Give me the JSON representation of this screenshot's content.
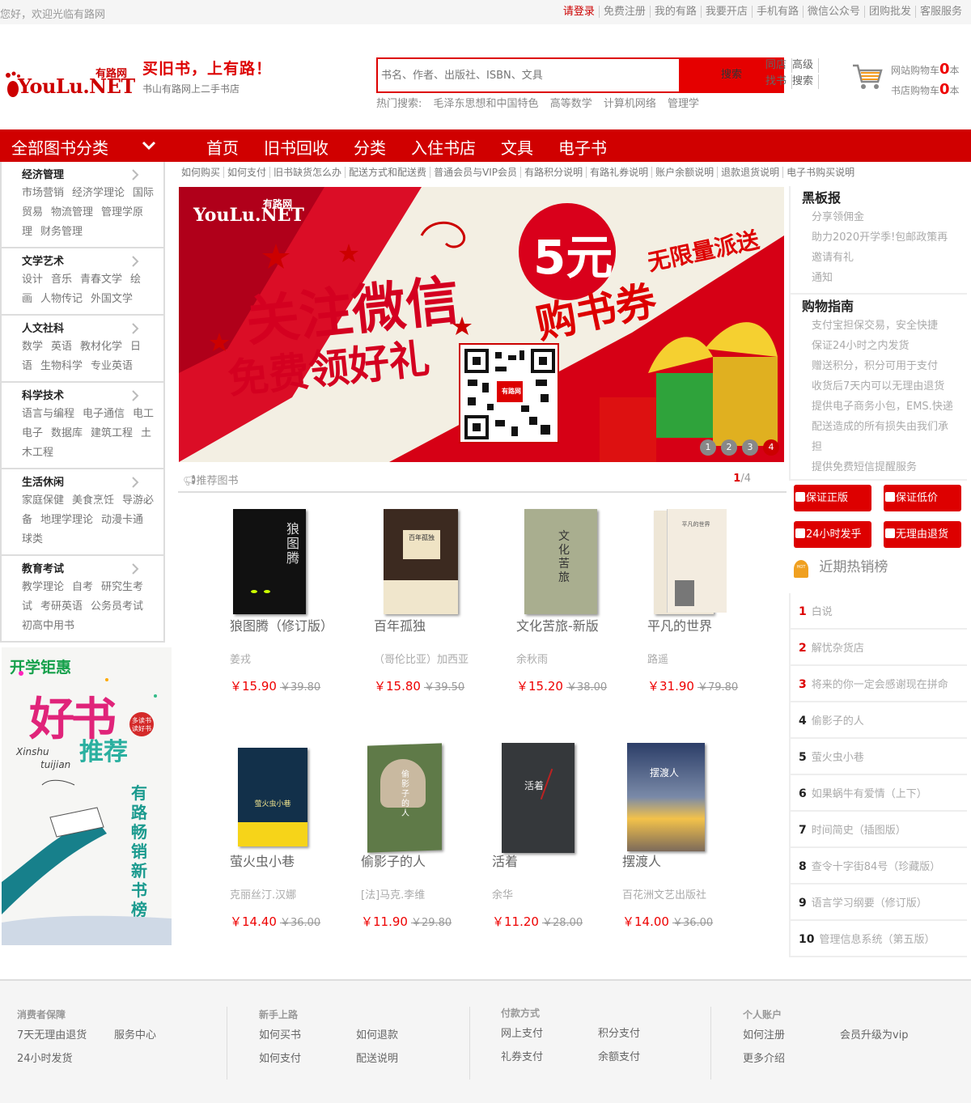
{
  "topbar": {
    "welcome": "您好，欢迎光临有路网",
    "links": [
      "请登录",
      "免费注册",
      "我的有路",
      "我要开店",
      "手机有路",
      "微信公众号",
      "团购批发",
      "客服服务"
    ]
  },
  "header": {
    "logo_text": "YouLu.NET",
    "logo_cn": "有路网",
    "slogan": "买旧书，上有路！",
    "sub_slogan": "书山有路网上二手书店",
    "search_placeholder": "书名、作者、出版社、ISBN、文具",
    "search_button": "搜索",
    "extra_links": [
      "同店",
      "高级",
      "找书",
      "搜索"
    ],
    "hot_label": "热门搜索:",
    "hot_terms": [
      "毛泽东思想和中国特色",
      "高等数学",
      "计算机网络",
      "管理学"
    ],
    "cart_site_label": "网站购物车",
    "cart_site_count": "0",
    "cart_shop_label": "书店购物车",
    "cart_shop_count": "0",
    "cart_unit": "本"
  },
  "nav": {
    "all_categories": "全部图书分类",
    "items": [
      "首页",
      "旧书回收",
      "分类",
      "入住书店",
      "文具",
      "电子书"
    ]
  },
  "categories": [
    {
      "title": "经济管理",
      "subs": [
        "市场营销",
        "经济学理论",
        "国际贸易",
        "物流管理",
        "管理学原理",
        "财务管理"
      ]
    },
    {
      "title": "文学艺术",
      "subs": [
        "设计",
        "音乐",
        "青春文学",
        "绘画",
        "人物传记",
        "外国文学"
      ]
    },
    {
      "title": "人文社科",
      "subs": [
        "数学",
        "英语",
        "教材化学",
        "日语",
        "生物科学",
        "专业英语"
      ]
    },
    {
      "title": "科学技术",
      "subs": [
        "语言与编程",
        "电子通信",
        "电工电子",
        "数据库",
        "建筑工程",
        "土木工程"
      ]
    },
    {
      "title": "生活休闲",
      "subs": [
        "家庭保健",
        "美食烹饪",
        "导游必备",
        "地理学理论",
        "动漫卡通",
        "球类"
      ]
    },
    {
      "title": "教育考试",
      "subs": [
        "教学理论",
        "自考",
        "研究生考试",
        "考研英语",
        "公务员考试",
        "初高中用书"
      ]
    }
  ],
  "side_promo": {
    "head": "开学钜惠",
    "big": "好书",
    "big2": "推荐",
    "pinyin1": "Xinshu",
    "pinyin2": "tuijian",
    "tag": "多读书 读好书",
    "vertical": "有路畅销新书榜"
  },
  "help_links": [
    "如何购买",
    "如何支付",
    "旧书缺货怎么办",
    "配送方式和配送费",
    "普通会员与VIP会员",
    "有路积分说明",
    "有路礼券说明",
    "账户余额说明",
    "退款退货说明",
    "电子书购买说明"
  ],
  "banner": {
    "logo_cn": "有路网",
    "logo_text": "YouLu.NET",
    "amount": "5元",
    "unlimited": "无限量派送",
    "coupon": "购书券",
    "follow": "关注微信",
    "gift": "免费领好礼",
    "qr_label": "有路网",
    "dots": [
      "1",
      "2",
      "3",
      "4"
    ],
    "active_dot": "4"
  },
  "recommend": {
    "label": "推荐图书",
    "page_current": "1",
    "page_total": "/4"
  },
  "books": [
    {
      "name": "狼图腾（修订版）",
      "author": "姜戎",
      "price": "￥15.90",
      "old": "￥39.80",
      "cover_title": "狼图腾"
    },
    {
      "name": "百年孤独",
      "author": "（哥伦比亚）加西亚",
      "price": "￥15.80",
      "old": "￥39.50",
      "cover_title": "百年孤独"
    },
    {
      "name": "文化苦旅-新版",
      "author": "余秋雨",
      "price": "￥15.20",
      "old": "￥38.00",
      "cover_title": "文化苦旅"
    },
    {
      "name": "平凡的世界",
      "author": "路遥",
      "price": "￥31.90",
      "old": "￥79.80",
      "cover_title": "平凡的世界"
    },
    {
      "name": "萤火虫小巷",
      "author": "克丽丝汀.汉娜",
      "price": "￥14.40",
      "old": "￥36.00",
      "cover_title": "萤火虫小巷"
    },
    {
      "name": "偷影子的人",
      "author": "[法]马克.李维",
      "price": "￥11.90",
      "old": "￥29.80",
      "cover_title": "偷影子的人"
    },
    {
      "name": "活着",
      "author": "余华",
      "price": "￥11.20",
      "old": "￥28.00",
      "cover_title": "活着"
    },
    {
      "name": "摆渡人",
      "author": "百花洲文艺出版社",
      "price": "￥14.00",
      "old": "￥36.00",
      "cover_title": "摆渡人"
    }
  ],
  "blackboard": {
    "title": "黑板报",
    "items": [
      "分享领佣金",
      "助力2020开学季!包邮政策再",
      "邀请有礼",
      "通知"
    ]
  },
  "guide": {
    "title": "购物指南",
    "items": [
      "支付宝担保交易，安全快捷",
      "保证24小时之内发货",
      "赠送积分，积分可用于支付",
      "收货后7天内可以无理由退货",
      "提供电子商务小包，EMS.快递",
      "配送造成的所有损失由我们承",
      "担",
      "提供免费短信提醒服务"
    ]
  },
  "guarantees": [
    "保证正版",
    "保证低价",
    "24小时发乎",
    "无理由退货"
  ],
  "hot": {
    "badge": "HOT",
    "title": "近期热销榜",
    "items": [
      {
        "rank": "1",
        "name": "白说"
      },
      {
        "rank": "2",
        "name": "解忧杂货店"
      },
      {
        "rank": "3",
        "name": "将来的你一定会感谢现在拼命"
      },
      {
        "rank": "4",
        "name": "偷影子的人"
      },
      {
        "rank": "5",
        "name": "萤火虫小巷"
      },
      {
        "rank": "6",
        "name": "如果蜗牛有爱情（上下）"
      },
      {
        "rank": "7",
        "name": "时间简史（插图版）"
      },
      {
        "rank": "8",
        "name": "查令十字街84号（珍藏版）"
      },
      {
        "rank": "9",
        "name": "语言学习纲要（修订版）"
      },
      {
        "rank": "10",
        "name": "管理信息系统（第五版）"
      }
    ]
  },
  "footer": [
    {
      "title": "消费者保障",
      "links": [
        "7天无理由退货",
        "服务中心",
        "24小时发货"
      ]
    },
    {
      "title": "新手上路",
      "links": [
        "如何买书",
        "如何退款",
        "如何支付",
        "配送说明"
      ]
    },
    {
      "title": "付款方式",
      "links": [
        "网上支付",
        "积分支付",
        "礼券支付",
        "余额支付"
      ]
    },
    {
      "title": "个人账户",
      "links": [
        "如何注册",
        "会员升级为vip",
        "更多介绍"
      ]
    }
  ]
}
